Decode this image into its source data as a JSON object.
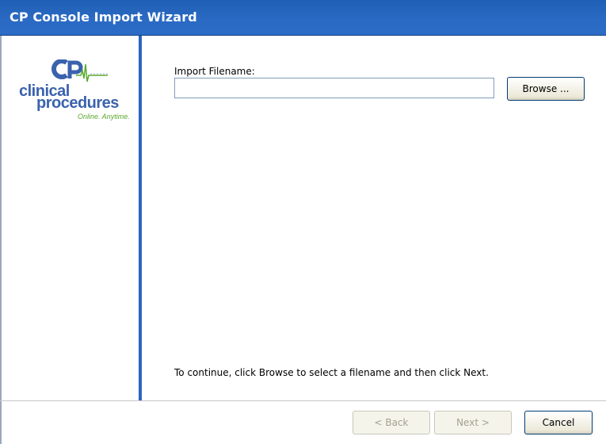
{
  "window": {
    "title": "CP Console Import Wizard"
  },
  "sidebar": {
    "logo": {
      "line1": "clinical",
      "line2": "procedures",
      "tagline": "Online. Anytime.",
      "colors": {
        "blue": "#3a62ad",
        "green": "#5aa92e"
      }
    }
  },
  "main": {
    "filename_label": "Import Filename:",
    "filename_value": "",
    "browse_label": "Browse ...",
    "instruction": "To continue, click Browse to select a filename and then click Next."
  },
  "footer": {
    "back_label": "< Back",
    "next_label": "Next >",
    "cancel_label": "Cancel"
  },
  "colors": {
    "titlebar": "#2a6ac3",
    "divider": "#2c64c2"
  }
}
